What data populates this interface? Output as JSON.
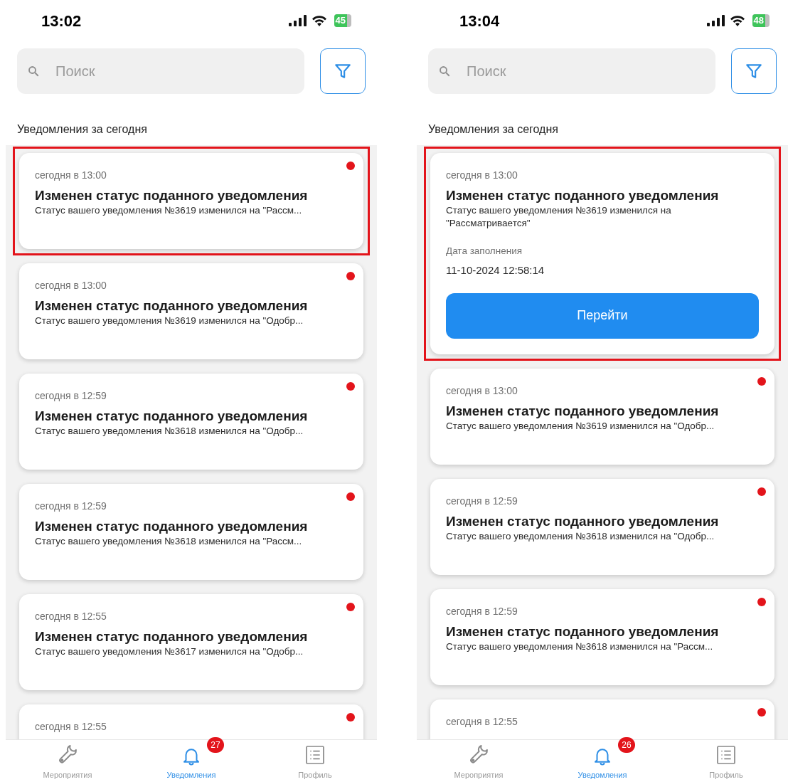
{
  "screens": [
    {
      "status_bar": {
        "time": "13:02",
        "battery": "45"
      },
      "search": {
        "placeholder": "Поиск"
      },
      "section_title": "Уведомления за сегодня",
      "notifications": [
        {
          "kind": "collapsed",
          "time": "сегодня в 13:00",
          "title": "Изменен статус поданного уведомления",
          "body": "Статус вашего уведомления №3619 изменился на \"Рассм...",
          "unread": true,
          "highlighted": true
        },
        {
          "kind": "collapsed",
          "time": "сегодня в 13:00",
          "title": "Изменен статус поданного уведомления",
          "body": "Статус вашего уведомления №3619 изменился на \"Одобр...",
          "unread": true,
          "highlighted": false
        },
        {
          "kind": "collapsed",
          "time": "сегодня в 12:59",
          "title": "Изменен статус поданного уведомления",
          "body": "Статус вашего уведомления №3618 изменился на \"Одобр...",
          "unread": true,
          "highlighted": false
        },
        {
          "kind": "collapsed",
          "time": "сегодня в 12:59",
          "title": "Изменен статус поданного уведомления",
          "body": "Статус вашего уведомления №3618 изменился на \"Рассм...",
          "unread": true,
          "highlighted": false
        },
        {
          "kind": "collapsed",
          "time": "сегодня в 12:55",
          "title": "Изменен статус поданного уведомления",
          "body": "Статус вашего уведомления №3617 изменился на \"Одобр...",
          "unread": true,
          "highlighted": false
        },
        {
          "kind": "collapsed",
          "time": "сегодня в 12:55",
          "unread": true,
          "highlighted": false
        }
      ],
      "tab_bar": [
        {
          "label": "Мероприятия",
          "selected": false
        },
        {
          "label": "Уведомления",
          "selected": true,
          "badge": "27"
        },
        {
          "label": "Профиль",
          "selected": false
        }
      ]
    },
    {
      "status_bar": {
        "time": "13:04",
        "battery": "48"
      },
      "search": {
        "placeholder": "Поиск"
      },
      "section_title": "Уведомления за сегодня",
      "notifications": [
        {
          "kind": "expanded",
          "time": "сегодня в 13:00",
          "title": "Изменен статус поданного уведомления",
          "body": "Статус вашего уведомления №3619 изменился на \"Рассматривается\"",
          "detail_label": "Дата заполнения",
          "detail_value": "11-10-2024 12:58:14",
          "action": "Перейти",
          "unread": false,
          "highlighted": true
        },
        {
          "kind": "collapsed",
          "time": "сегодня в 13:00",
          "title": "Изменен статус поданного уведомления",
          "body": "Статус вашего уведомления №3619 изменился на \"Одобр...",
          "unread": true,
          "highlighted": false
        },
        {
          "kind": "collapsed",
          "time": "сегодня в 12:59",
          "title": "Изменен статус поданного уведомления",
          "body": "Статус вашего уведомления №3618 изменился на \"Одобр...",
          "unread": true,
          "highlighted": false
        },
        {
          "kind": "collapsed",
          "time": "сегодня в 12:59",
          "title": "Изменен статус поданного уведомления",
          "body": "Статус вашего уведомления №3618 изменился на \"Рассм...",
          "unread": true,
          "highlighted": false
        },
        {
          "kind": "collapsed",
          "time": "сегодня в 12:55",
          "unread": true,
          "highlighted": false
        }
      ],
      "tab_bar": [
        {
          "label": "Мероприятия",
          "selected": false
        },
        {
          "label": "Уведомления",
          "selected": true,
          "badge": "26"
        },
        {
          "label": "Профиль",
          "selected": false
        }
      ]
    }
  ]
}
